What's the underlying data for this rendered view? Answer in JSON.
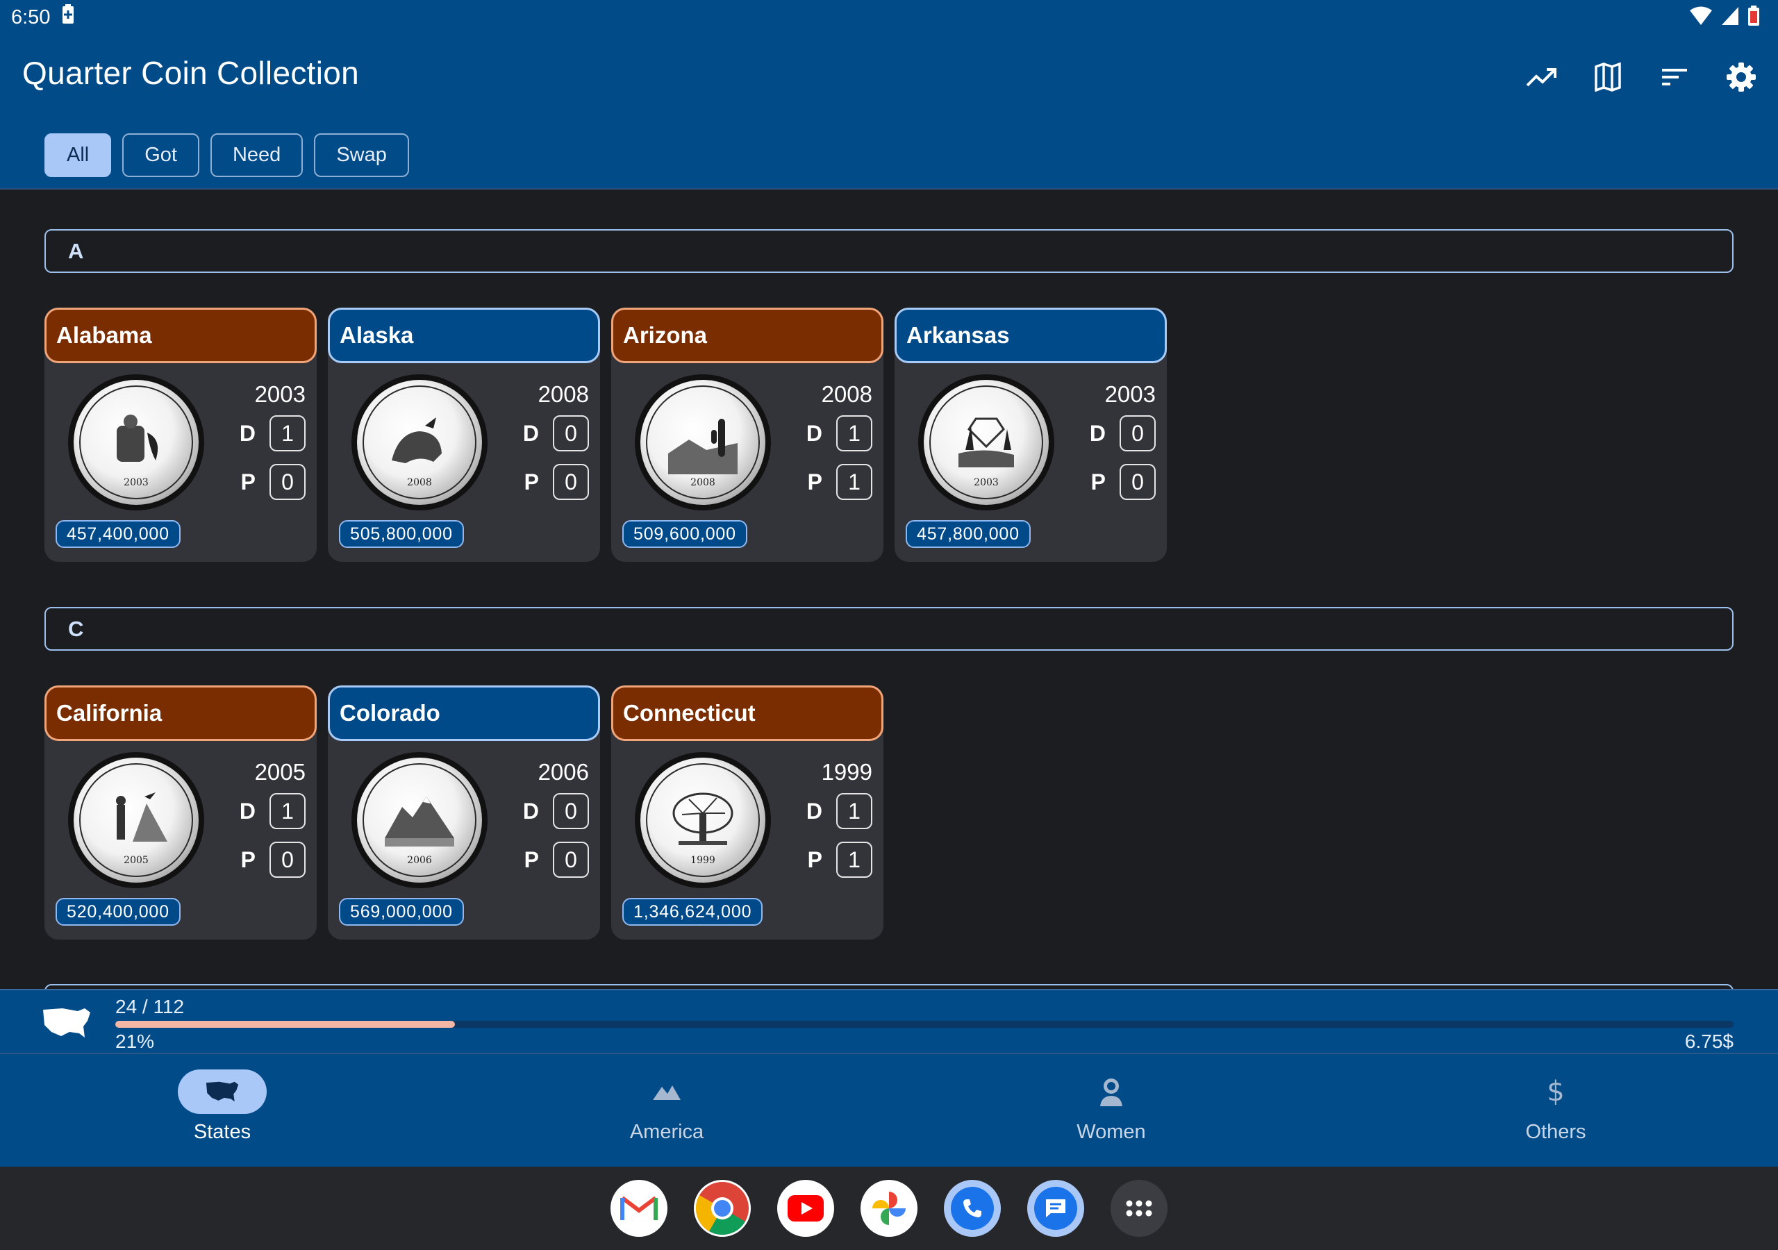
{
  "status": {
    "time": "6:50"
  },
  "app": {
    "title": "Quarter Coin Collection"
  },
  "toolbar": {
    "actions": [
      {
        "icon": "trending-up-icon"
      },
      {
        "icon": "map-icon"
      },
      {
        "icon": "sort-icon"
      },
      {
        "icon": "gear-icon"
      }
    ]
  },
  "filters": {
    "selected": "All",
    "chips": [
      "All",
      "Got",
      "Need",
      "Swap"
    ]
  },
  "sections": [
    {
      "letter": "A",
      "coins": [
        {
          "name": "Alabama",
          "year": "2003",
          "d": "1",
          "p": "0",
          "mintage": "457,400,000",
          "style": "bronze"
        },
        {
          "name": "Alaska",
          "year": "2008",
          "d": "0",
          "p": "0",
          "mintage": "505,800,000",
          "style": "blue"
        },
        {
          "name": "Arizona",
          "year": "2008",
          "d": "1",
          "p": "1",
          "mintage": "509,600,000",
          "style": "bronze"
        },
        {
          "name": "Arkansas",
          "year": "2003",
          "d": "0",
          "p": "0",
          "mintage": "457,800,000",
          "style": "blue"
        }
      ]
    },
    {
      "letter": "C",
      "coins": [
        {
          "name": "California",
          "year": "2005",
          "d": "1",
          "p": "0",
          "mintage": "520,400,000",
          "style": "bronze"
        },
        {
          "name": "Colorado",
          "year": "2006",
          "d": "0",
          "p": "0",
          "mintage": "569,000,000",
          "style": "blue"
        },
        {
          "name": "Connecticut",
          "year": "1999",
          "d": "1",
          "p": "1",
          "mintage": "1,346,624,000",
          "style": "bronze"
        }
      ]
    }
  ],
  "mint_labels": {
    "d": "D",
    "p": "P"
  },
  "progress": {
    "count": "24 / 112",
    "percent_label": "21%",
    "fraction": 0.21,
    "value": "6.75$"
  },
  "bottom_nav": {
    "selected": "States",
    "items": [
      {
        "label": "States",
        "icon": "usa-map-icon"
      },
      {
        "label": "America",
        "icon": "mountain-icon"
      },
      {
        "label": "Women",
        "icon": "woman-icon"
      },
      {
        "label": "Others",
        "icon": "dollar-icon"
      }
    ]
  },
  "dock": {
    "apps": [
      "gmail-icon",
      "chrome-icon",
      "youtube-icon",
      "photos-icon",
      "phone-icon",
      "messages-icon",
      "app-drawer-icon"
    ]
  },
  "colors": {
    "appbar": "#004b88",
    "background": "#1c1d21",
    "card": "#33343a",
    "bronze_header": "#7a2d00",
    "blue_header": "#004a8a",
    "accent": "#a9c8f7",
    "progress_fill": "#f4b7a5"
  }
}
